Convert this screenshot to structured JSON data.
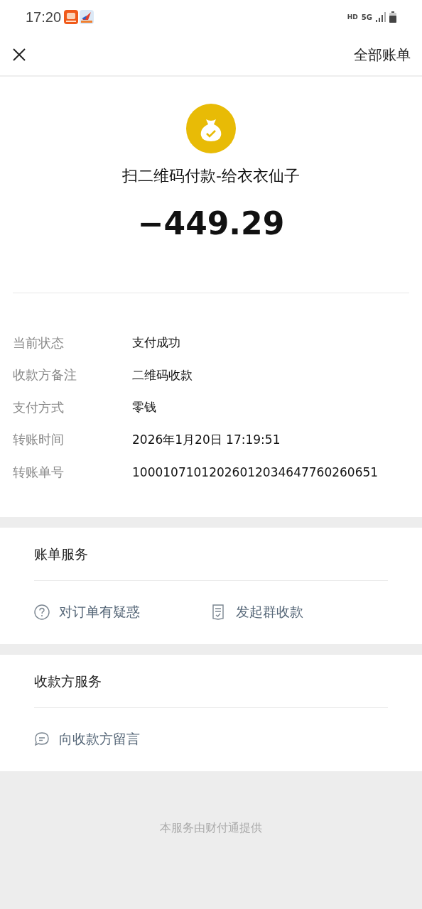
{
  "status_bar": {
    "time": "17:20",
    "network_labels": [
      "HD",
      "5G"
    ]
  },
  "nav": {
    "action": "全部账单"
  },
  "payment": {
    "title": "扫二维码付款-给衣衣仙子",
    "amount": "−449.29"
  },
  "details": [
    {
      "label": "当前状态",
      "value": "支付成功"
    },
    {
      "label": "收款方备注",
      "value": "二维码收款"
    },
    {
      "label": "支付方式",
      "value": "零钱"
    },
    {
      "label": "转账时间",
      "value": "2026年1月20日 17:19:51"
    },
    {
      "label": "转账单号",
      "value": "10001071012026012034647760260651"
    }
  ],
  "service_sections": [
    {
      "title": "账单服务",
      "items": [
        {
          "kind": "question",
          "label": "对订单有疑惑"
        },
        {
          "kind": "receipt",
          "label": "发起群收款"
        }
      ]
    },
    {
      "title": "收款方服务",
      "items": [
        {
          "kind": "message",
          "label": "向收款方留言"
        }
      ]
    }
  ],
  "footer": "本服务由财付通提供"
}
